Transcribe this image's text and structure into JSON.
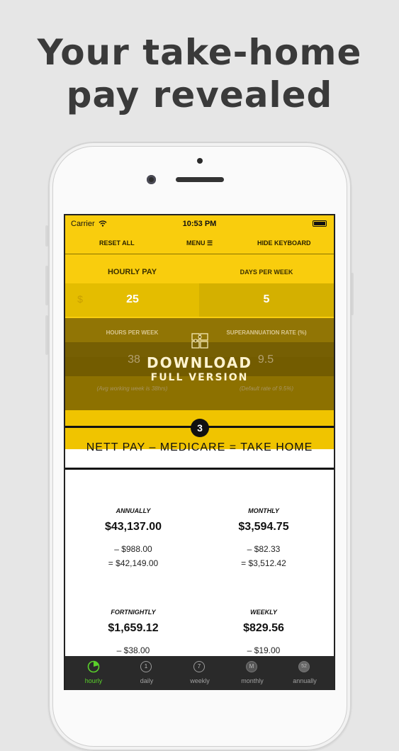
{
  "headline": {
    "line1": "Your take-home",
    "line2": "pay revealed"
  },
  "status_bar": {
    "carrier": "Carrier",
    "time": "10:53 PM"
  },
  "toolbar": {
    "reset": "RESET ALL",
    "menu": "MENU ☰",
    "hide_keyboard": "HIDE KEYBOARD"
  },
  "inputs": {
    "hourly_pay": {
      "label": "HOURLY PAY",
      "currency": "$",
      "value": "25"
    },
    "days_per_week": {
      "label": "DAYS PER WEEK",
      "value": "5"
    },
    "hours_per_week": {
      "label": "HOURS PER WEEK",
      "value": "38",
      "hint": "(Avg working week is 38hrs)"
    },
    "super_rate": {
      "label": "SUPERANNUATION RATE (%)",
      "value": "9.5",
      "hint": "(Default rate of 9.5%)"
    }
  },
  "download": {
    "line1": "DOWNLOAD",
    "line2": "FULL VERSION"
  },
  "step": {
    "number": "3",
    "title": "NETT PAY – MEDICARE = TAKE HOME"
  },
  "results": [
    {
      "label": "ANNUALLY",
      "amount": "$43,137.00",
      "medicare": "– $988.00",
      "take_home": "= $42,149.00"
    },
    {
      "label": "MONTHLY",
      "amount": "$3,594.75",
      "medicare": "– $82.33",
      "take_home": "= $3,512.42"
    },
    {
      "label": "FORTNIGHTLY",
      "amount": "$1,659.12",
      "medicare": "– $38.00",
      "take_home": ""
    },
    {
      "label": "WEEKLY",
      "amount": "$829.56",
      "medicare": "– $19.00",
      "take_home": ""
    }
  ],
  "tabs": [
    {
      "label": "hourly",
      "icon": "",
      "active": true
    },
    {
      "label": "daily",
      "icon": "1",
      "active": false
    },
    {
      "label": "weekly",
      "icon": "7",
      "active": false
    },
    {
      "label": "monthly",
      "icon": "M",
      "active": false
    },
    {
      "label": "annually",
      "icon": "52",
      "active": false
    }
  ],
  "colors": {
    "accent": "#f9cd0d",
    "active_tab": "#5ad12b",
    "tabbar": "#2a2a2a"
  }
}
